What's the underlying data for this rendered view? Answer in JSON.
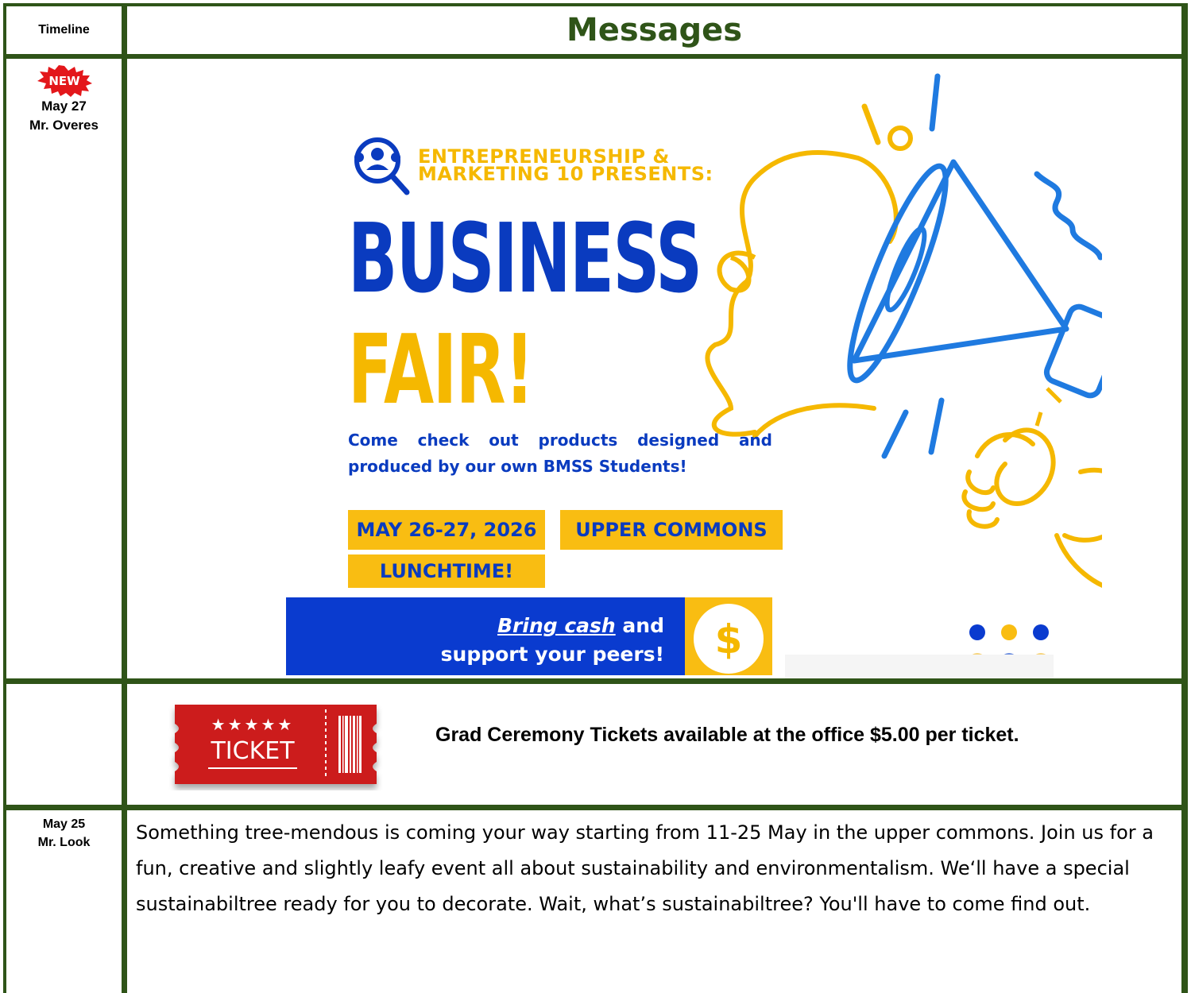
{
  "table": {
    "timeline_header": "Timeline",
    "messages_header": "Messages"
  },
  "rows": [
    {
      "badge": "NEW",
      "date": "May 27",
      "author": "Mr. Overes",
      "poster": {
        "presents": "ENTREPRENEURSHIP & MARKETING 10 PRESENTS:",
        "title_line1": "BUSINESS",
        "title_line2": "FAIR!",
        "description": "Come check out products designed and produced by our own BMSS Students!",
        "date_tag": "MAY 26-27, 2026",
        "location_tag": "UPPER COMMONS",
        "time_tag": "LUNCHTIME!",
        "bring_cash": "Bring cash",
        "and": "and",
        "support": "support your peers!",
        "dollar": "$"
      }
    },
    {
      "ticket_stars": "★★★★★",
      "ticket_label": "TICKET",
      "message": "Grad Ceremony Tickets available at the office $5.00 per ticket."
    },
    {
      "date": "May 25",
      "author": "Mr. Look",
      "message": "Something tree-mendous is coming your way starting from 11-25 May in the upper commons. Join us for a fun, creative and slightly leafy event all about sustainability and environmentalism. We‘ll have a special sustainabiltree ready for you to decorate. Wait, what’s sustainabiltree? You'll have to come find out."
    }
  ],
  "colors": {
    "border": "#2f5418",
    "header_text": "#2f5418",
    "poster_blue": "#0a3bbf",
    "poster_yellow": "#f5b800",
    "ticket_red": "#cc1f1f"
  }
}
